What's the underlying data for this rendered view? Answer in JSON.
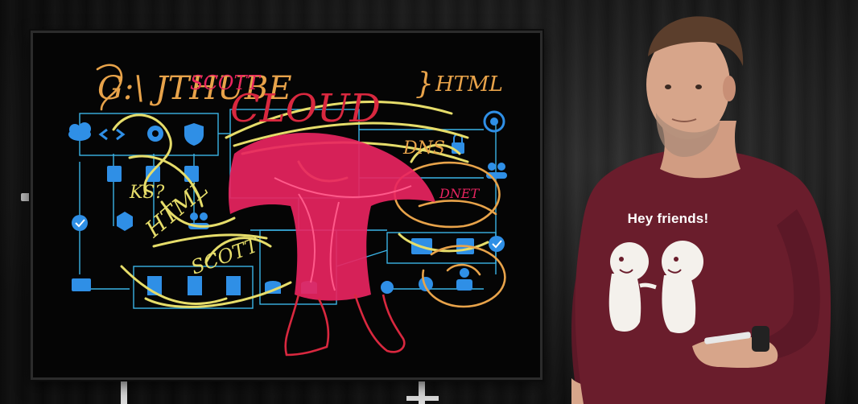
{
  "scene": {
    "description_free": true
  },
  "board": {
    "handwriting": {
      "top_left": "G:\\ JTHUBE",
      "top_left_overlay": "SCOTT",
      "cloud": "CLOUD",
      "html": "HTML",
      "brace": "}",
      "ks": "KS?",
      "html_vertical": "HTML",
      "scott_lower": "SCOTT",
      "dns": "DNS",
      "right_scribble": "DNET"
    },
    "ink_colors": {
      "orange": "#e8a34a",
      "yellow": "#e6dd6a",
      "pink": "#e8245f",
      "red": "#d9283f",
      "diagram_line": "#3bb3e6",
      "icon_blue": "#2f8fe6"
    },
    "icons": [
      "cloud-icon",
      "code-icon",
      "shield-icon",
      "database-icon",
      "database-icon",
      "database-icon",
      "gear-icon",
      "checkmark-icon",
      "cube-icon",
      "people-icon",
      "building-icon",
      "building-icon",
      "building-icon",
      "storage-icon",
      "storage-icon",
      "lock-icon",
      "target-icon",
      "people-icon",
      "server-icon",
      "checkmark-icon",
      "person-icon",
      "monitor-icon"
    ]
  },
  "person": {
    "shirt_text": "Hey friends!",
    "shirt_color": "#6a1d2c"
  }
}
